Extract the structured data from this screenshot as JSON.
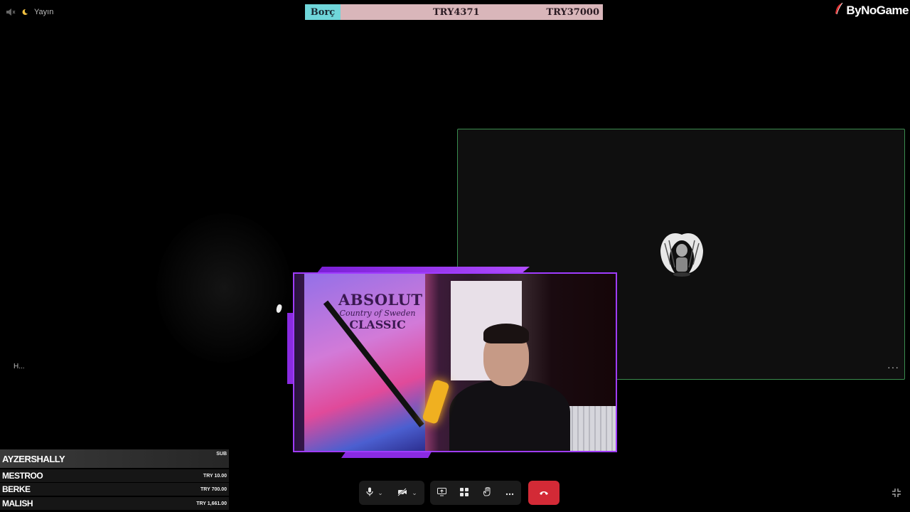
{
  "top_left": {
    "status_label": "Yayın",
    "icons": [
      "speaker-muted-icon",
      "moon-icon"
    ]
  },
  "debt_bar": {
    "label": "Borç",
    "current": "TRY4371",
    "target": "TRY37000",
    "label_color": "#6fd6da",
    "bar_color": "#d9b6ba"
  },
  "brand": {
    "name": "ByNoGame",
    "icon": "feather-logo-icon"
  },
  "left_participant": {
    "name_truncated": "H..."
  },
  "right_participant": {
    "more_label": "···",
    "avatar": "winged-angel-avatar",
    "border_color": "#3a8c4e"
  },
  "webcam": {
    "frame_color": "#a03cff",
    "poster": {
      "line1": "ABSOLUT",
      "line2": "Country of Sweden",
      "line3": "CLASSIC"
    }
  },
  "events": [
    {
      "name": "AYZERSHALLY",
      "amount": "SUB"
    },
    {
      "name": "MESTROO",
      "amount": "TRY 10.00"
    },
    {
      "name": "BERKE",
      "amount": "TRY 700.00"
    },
    {
      "name": "MALISH",
      "amount": "TRY 1,661.00"
    }
  ],
  "controls": {
    "items": [
      "microphone-icon",
      "camera-off-icon",
      "share-screen-icon",
      "apps-icon",
      "raise-hand-icon",
      "more-icon",
      "leave-call-icon"
    ],
    "leave_color": "#d32a36"
  },
  "fullscreen": {
    "icon": "exit-fullscreen-icon"
  }
}
